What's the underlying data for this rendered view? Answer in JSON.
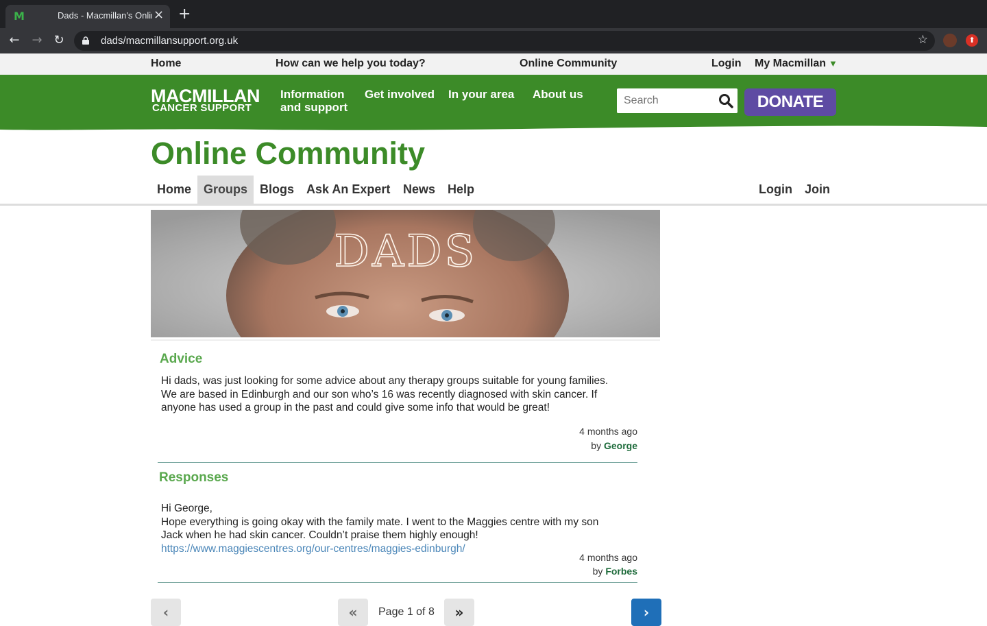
{
  "browser": {
    "tab_title": "Dads  - Macmillan's Online Community",
    "url": "dads/macmillansupport.org.uk",
    "favicon": "M"
  },
  "topbar": {
    "home": "Home",
    "help": "How can we help you today?",
    "community": "Online Community",
    "login": "Login",
    "my_macmillan": "My Macmillan"
  },
  "header": {
    "logo_main": "MACMILLAN",
    "logo_sub": "CANCER SUPPORT",
    "nav": {
      "info_line1": "Information",
      "info_line2": "and support",
      "involved": "Get involved",
      "area": "In your area",
      "about": "About us"
    },
    "search_placeholder": "Search",
    "donate": "DONATE",
    "green": "#3c8b28",
    "purple": "#5e4ba3"
  },
  "community": {
    "title": "Online Community",
    "subnav": {
      "home": "Home",
      "groups": "Groups",
      "blogs": "Blogs",
      "expert": "Ask An Expert",
      "news": "News",
      "help": "Help",
      "login": "Login",
      "join": "Join"
    }
  },
  "banner": {
    "text": "DADS"
  },
  "thread": {
    "advice_heading": "Advice",
    "post_line1": "Hi dads, was just looking for some advice about any therapy groups suitable for young families.",
    "post_line2": "We are based in Edinburgh and our son who’s 16 was recently diagnosed with skin cancer. If",
    "post_line3": "anyone has used a group in the past and could give some info that would be great!",
    "post_time": "4 months ago",
    "post_by": "by",
    "post_author": "George",
    "responses_heading": "Responses",
    "reply_line1": "Hi George,",
    "reply_line2": "Hope everything is going okay with the family mate. I went to the Maggies centre with my son",
    "reply_line3": "Jack when he had skin cancer. Couldn’t praise them highly enough!",
    "reply_link": "https://www.maggiescentres.org/our-centres/maggies-edinburgh/",
    "reply_time": "4 months ago",
    "reply_by": "by",
    "reply_author": "Forbes"
  },
  "pagination": {
    "label": "Page 1 of 8"
  }
}
